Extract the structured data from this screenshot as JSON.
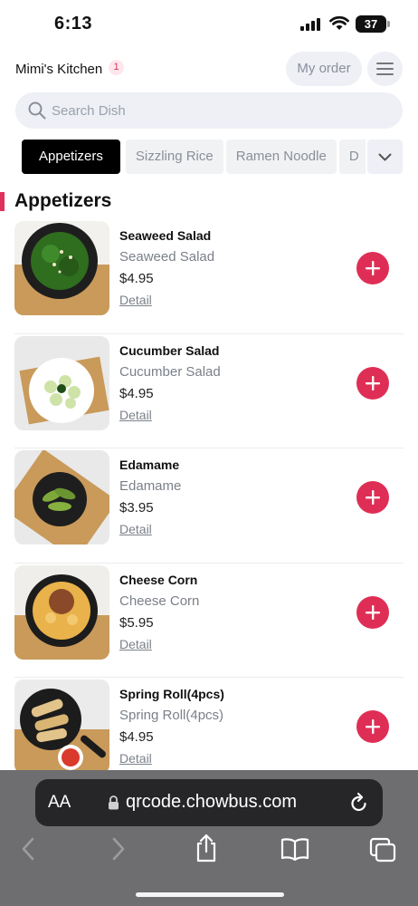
{
  "status_bar": {
    "time": "6:13",
    "battery": "37"
  },
  "header": {
    "store_name": "Mimi's Kitchen",
    "badge_count": "1",
    "my_order_label": "My order"
  },
  "search": {
    "placeholder": "Search Dish",
    "value": ""
  },
  "tabs": [
    {
      "label": "Appetizers",
      "active": true
    },
    {
      "label": "Sizzling Rice",
      "active": false
    },
    {
      "label": "Ramen Noodle",
      "active": false
    },
    {
      "label": "D",
      "active": false
    }
  ],
  "section": {
    "title": "Appetizers",
    "accent_color": "#e0315a"
  },
  "dishes": [
    {
      "name": "Seaweed Salad",
      "subtitle": "Seaweed Salad",
      "price": "$4.95",
      "detail_label": "Detail"
    },
    {
      "name": "Cucumber Salad",
      "subtitle": "Cucumber Salad",
      "price": "$4.95",
      "detail_label": "Detail"
    },
    {
      "name": "Edamame",
      "subtitle": "Edamame",
      "price": "$3.95",
      "detail_label": "Detail"
    },
    {
      "name": "Cheese Corn",
      "subtitle": "Cheese Corn",
      "price": "$5.95",
      "detail_label": "Detail"
    },
    {
      "name": "Spring Roll(4pcs)",
      "subtitle": "Spring Roll(4pcs)",
      "price": "$4.95",
      "detail_label": "Detail"
    }
  ],
  "browser": {
    "text_size_label": "AA",
    "url": "qrcode.chowbus.com"
  },
  "icons": {
    "menu": "hamburger-icon",
    "search": "search-icon",
    "tabs_more": "chevron-down-icon",
    "add": "plus-icon",
    "lock": "lock-icon",
    "reload": "reload-icon",
    "back": "back-arrow-icon",
    "forward": "forward-arrow-icon",
    "share": "share-icon",
    "bookmarks": "book-icon",
    "tabs": "tabs-icon"
  },
  "colors": {
    "accent": "#df2e55",
    "pill_bg": "#eef0f6",
    "active_tab": "#000000"
  }
}
